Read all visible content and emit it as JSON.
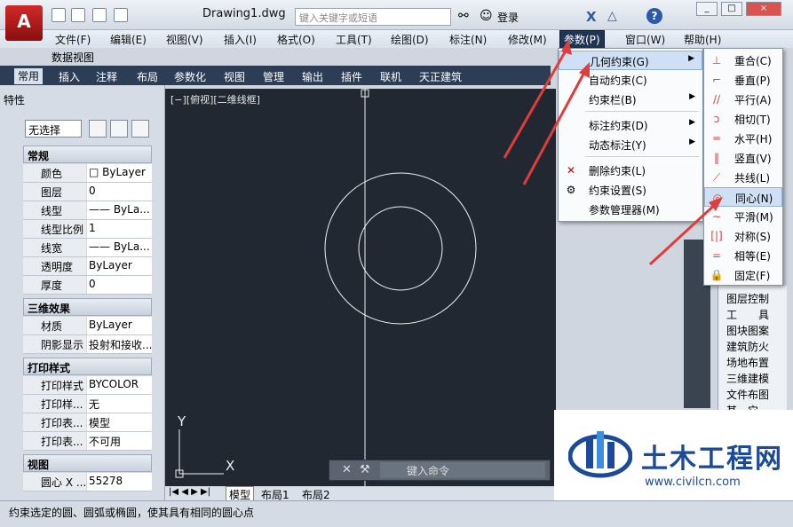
{
  "window": {
    "doc_title": "Drawing1.dwg",
    "search_placeholder": "键入关键字或短语",
    "login": "登录",
    "help": "?",
    "min": "_",
    "restore": "□",
    "close": "×"
  },
  "menubar": {
    "items": [
      "文件(F)",
      "编辑(E)",
      "视图(V)",
      "插入(I)",
      "格式(O)",
      "工具(T)",
      "绘图(D)",
      "标注(N)",
      "修改(M)",
      "参数(P)",
      "窗口(W)",
      "帮助(H)"
    ],
    "subrow": "数据视图"
  },
  "ribbon": {
    "tabs": [
      "常用",
      "插入",
      "注释",
      "布局",
      "参数化",
      "视图",
      "管理",
      "输出",
      "插件",
      "联机",
      "天正建筑"
    ]
  },
  "palette": {
    "title": "特性",
    "selection": "无选择",
    "sections": {
      "general": "常规",
      "three_d": "三维效果",
      "plot": "打印样式",
      "view": "视图"
    },
    "general": [
      [
        "颜色",
        "□ ByLayer"
      ],
      [
        "图层",
        "0"
      ],
      [
        "线型",
        "—— ByLa..."
      ],
      [
        "线型比例",
        "1"
      ],
      [
        "线宽",
        "—— ByLa..."
      ],
      [
        "透明度",
        "ByLayer"
      ],
      [
        "厚度",
        "0"
      ]
    ],
    "three_d": [
      [
        "材质",
        "ByLayer"
      ],
      [
        "阴影显示",
        "投射和接收..."
      ]
    ],
    "plot": [
      [
        "打印样式",
        "BYCOLOR"
      ],
      [
        "打印样...",
        "无"
      ],
      [
        "打印表...",
        "模型"
      ],
      [
        "打印表...",
        "不可用"
      ]
    ],
    "view": [
      [
        "圆心 X ...",
        "55278"
      ]
    ]
  },
  "canvas": {
    "viewport_label": "[−][俯视][二维线框]",
    "axis_y": "Y",
    "axis_x": "X"
  },
  "layout_tabs": [
    "模型",
    "布局1",
    "布局2"
  ],
  "command": {
    "placeholder": "键入命令"
  },
  "status": {
    "text": "约束选定的圆、圆弧或椭圆，使其具有相同的圆心点"
  },
  "param_menu": {
    "items": [
      "几何约束(G)",
      "自动约束(C)",
      "约束栏(B)",
      "标注约束(D)",
      "动态标注(Y)",
      "删除约束(L)",
      "约束设置(S)",
      "参数管理器(M)"
    ]
  },
  "geo_menu": {
    "items": [
      "重合(C)",
      "垂直(P)",
      "平行(A)",
      "相切(T)",
      "水平(H)",
      "竖直(V)",
      "共线(L)",
      "同心(N)",
      "平滑(M)",
      "对称(S)",
      "相等(E)",
      "固定(F)"
    ]
  },
  "tool_list": {
    "items": [
      "图层控制",
      "工　　具",
      "图块图案",
      "建筑防火",
      "场地布置",
      "三维建模",
      "文件布图",
      "其　它"
    ]
  },
  "watermark": {
    "title": "土木工程网",
    "url": "www.civilcn.com"
  },
  "colors": {
    "accent_red": "#e03c3c",
    "canvas_bg": "#212832",
    "menu_active": "#1f3553"
  }
}
